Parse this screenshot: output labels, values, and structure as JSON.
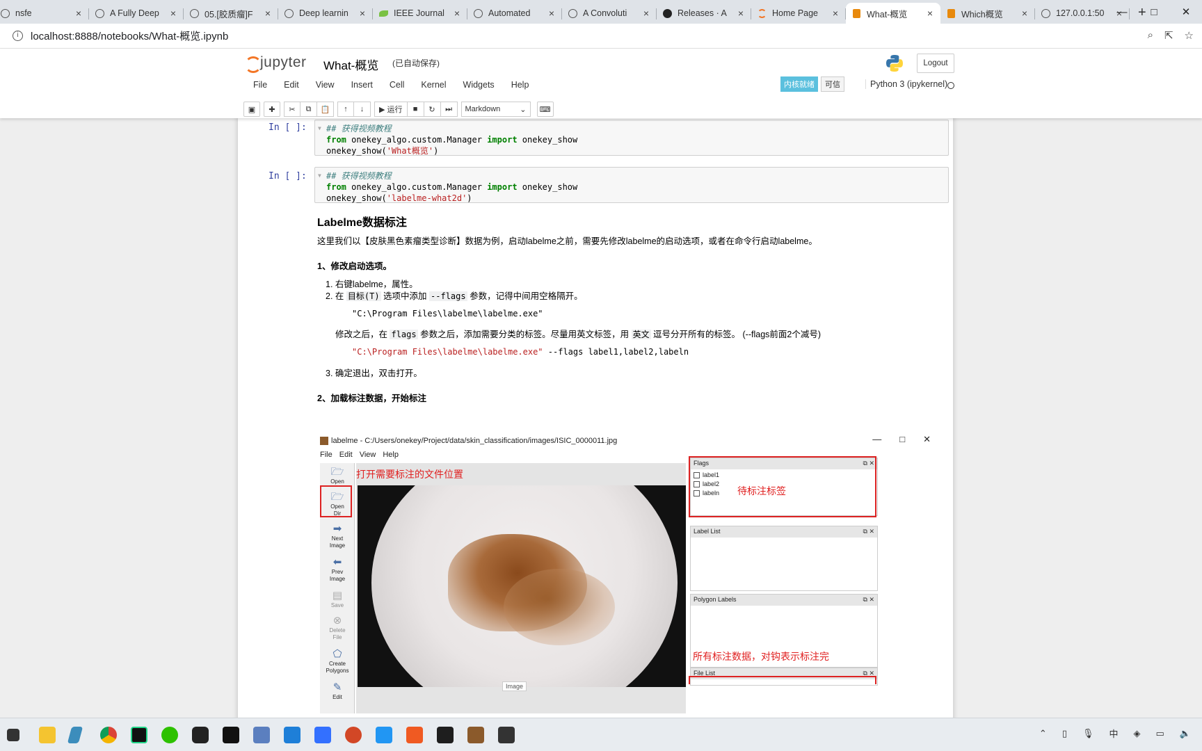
{
  "browser": {
    "tabs": [
      {
        "label": "nsfe",
        "icon": "globe-icon"
      },
      {
        "label": "A Fully Deep",
        "icon": "globe-icon"
      },
      {
        "label": "05.[胶质瘤]F",
        "icon": "globe-icon"
      },
      {
        "label": "Deep learnin",
        "icon": "globe-icon"
      },
      {
        "label": "IEEE Journal",
        "icon": "leaf-icon"
      },
      {
        "label": "Automated",
        "icon": "globe-icon"
      },
      {
        "label": "A Convoluti",
        "icon": "globe-icon"
      },
      {
        "label": "Releases · A",
        "icon": "github-icon"
      },
      {
        "label": "Home Page",
        "icon": "jupyter-icon"
      },
      {
        "label": "What-概览",
        "icon": "notebook-icon",
        "active": true
      },
      {
        "label": "Which概览",
        "icon": "notebook-icon"
      },
      {
        "label": "127.0.0.1:50",
        "icon": "globe-icon"
      }
    ],
    "new_tab": "+",
    "url": "localhost:8888/notebooks/What-概览.ipynb",
    "window_controls": [
      "—",
      "□",
      "✕"
    ]
  },
  "jupyter": {
    "logo_text": "jupyter",
    "notebook_name": "What-概览",
    "autosave": "(已自动保存)",
    "logout": "Logout",
    "menu": [
      "File",
      "Edit",
      "View",
      "Insert",
      "Cell",
      "Kernel",
      "Widgets",
      "Help"
    ],
    "kernel_status": "内核就绪",
    "trusted": "可信",
    "kernel_name": "Python 3 (ipykernel)",
    "run_label": "▶ 运行",
    "cell_type": "Markdown"
  },
  "cells": [
    {
      "prompt": "In [ ]:",
      "comment": "## 获得视频教程",
      "line2": {
        "kw1": "from",
        "module": " onekey_algo.custom.Manager ",
        "kw2": "import",
        "name": " onekey_show"
      },
      "line3": {
        "call": "onekey_show(",
        "arg": "'What概览'",
        "end": ")"
      }
    },
    {
      "prompt": "In [ ]:",
      "comment": "## 获得视频教程",
      "line2": {
        "kw1": "from",
        "module": " onekey_algo.custom.Manager ",
        "kw2": "import",
        "name": " onekey_show"
      },
      "line3": {
        "call": "onekey_show(",
        "arg": "'labelme-what2d'",
        "end": ")"
      }
    }
  ],
  "markdown": {
    "title": "Labelme数据标注",
    "intro": "这里我们以【皮肤黑色素瘤类型诊断】数据为例，启动labelme之前，需要先修改labelme的启动选项，或者在命令行启动labelme。",
    "section1": "1、修改启动选项。",
    "step1": "1. 右键labelme，属性。",
    "step2_pre": "2. 在 ",
    "step2_code1": "目标(T)",
    "step2_mid": " 选项中添加 ",
    "step2_code2": "--flags",
    "step2_post": " 参数，记得中间用空格隔开。",
    "path1": "\"C:\\Program Files\\labelme\\labelme.exe\"",
    "after_pre": "修改之后，在 ",
    "after_code": "flags",
    "after_mid": " 参数之后，添加需要分类的标签。尽量用英文标签，用 ",
    "after_code2": "英文",
    "after_post": " 逗号分开所有的标签。 (--flags前面2个减号)",
    "path2": "\"C:\\Program Files\\labelme\\labelme.exe\"",
    "path2_tail": " --flags label1,label2,labeln",
    "step3": "3. 确定退出，双击打开。",
    "section2": "2、加载标注数据，开始标注"
  },
  "labelme": {
    "title": "labelme - C:/Users/onekey/Project/data/skin_classification/images/ISIC_0000011.jpg",
    "menu": [
      "File",
      "Edit",
      "View",
      "Help"
    ],
    "tools": [
      {
        "label": "Open",
        "icon": "folder-icon"
      },
      {
        "label": "Open\nDir",
        "icon": "folder-icon"
      },
      {
        "label": "Next\nImage",
        "icon": "arrow-right-icon"
      },
      {
        "label": "Prev\nImage",
        "icon": "arrow-left-icon"
      },
      {
        "label": "Save",
        "icon": "save-icon"
      },
      {
        "label": "Delete\nFile",
        "icon": "delete-icon"
      },
      {
        "label": "Create\nPolygons",
        "icon": "polygon-icon"
      },
      {
        "label": "Edit",
        "icon": "edit-icon"
      }
    ],
    "annotation_open": "打开需要标注的文件位置",
    "annotation_flags": "待标注标签",
    "annotation_done": "所有标注数据，对钩表示标注完",
    "image_label": "Image",
    "docks": {
      "flags": "Flags",
      "flag_items": [
        "label1",
        "label2",
        "labeln"
      ],
      "label_list": "Label List",
      "polygon_labels": "Polygon Labels",
      "file_list": "File List"
    }
  }
}
